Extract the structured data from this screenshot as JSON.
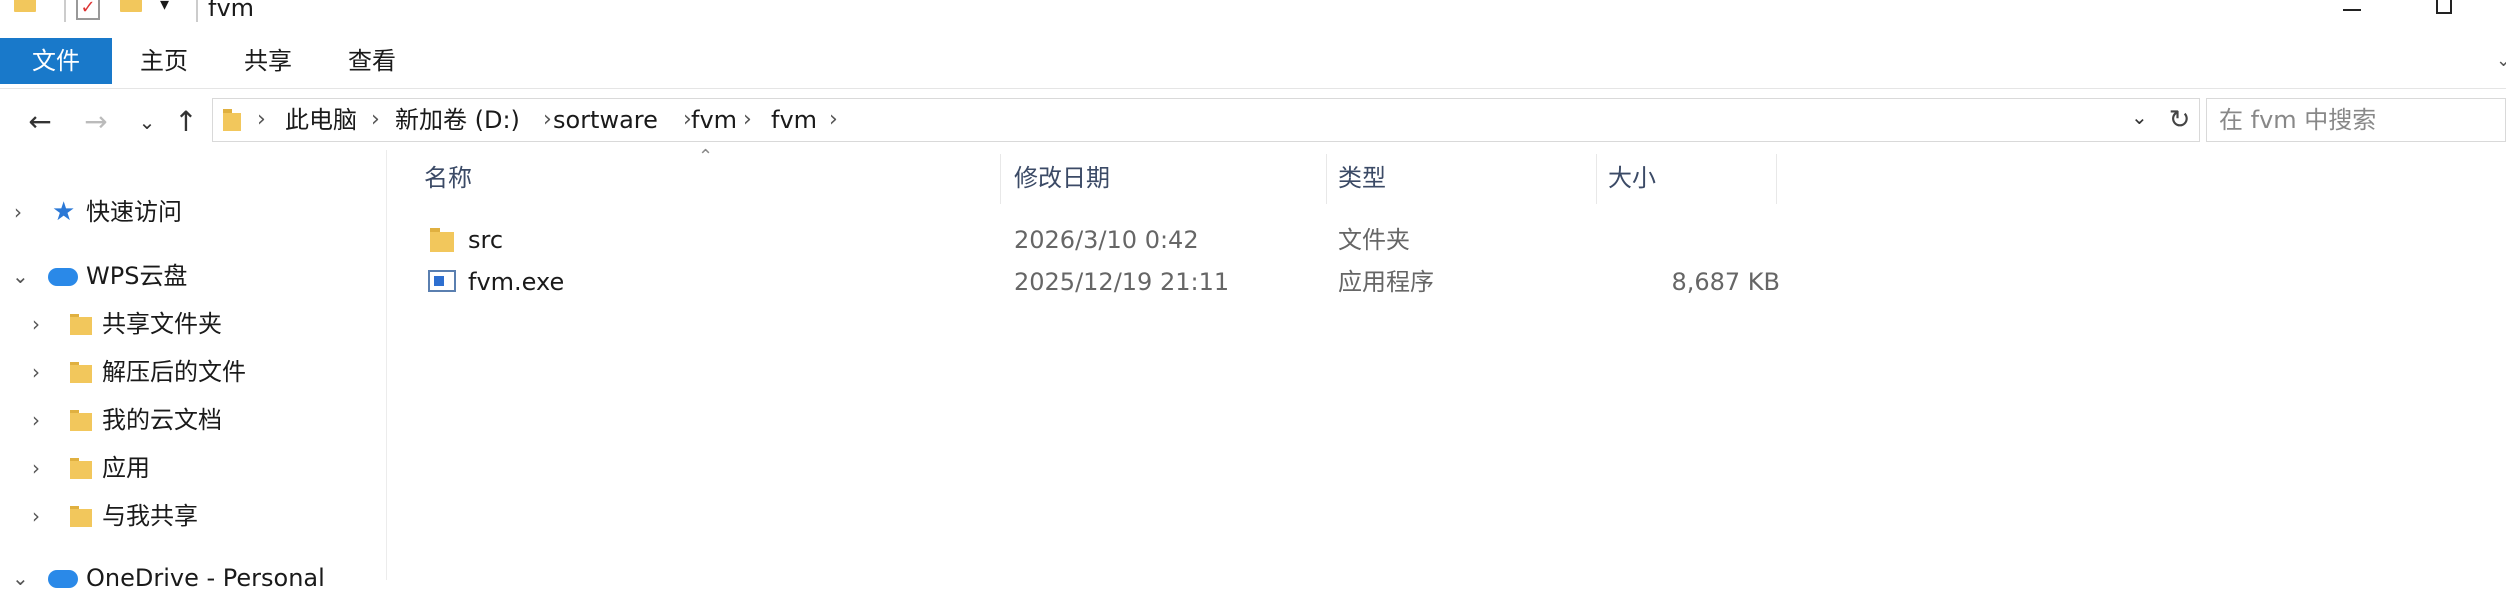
{
  "window": {
    "title": "fvm"
  },
  "ribbon": {
    "tabs": [
      "文件",
      "主页",
      "共享",
      "查看"
    ],
    "active_tab": "文件"
  },
  "address_bar": {
    "breadcrumbs": [
      "此电脑",
      "新加卷 (D:)",
      "sortware",
      "fvm",
      "fvm"
    ]
  },
  "search": {
    "placeholder": "在 fvm 中搜索"
  },
  "nav_pane": {
    "items": [
      {
        "label": "快速访问",
        "icon": "star-icon",
        "expanded": false
      },
      {
        "label": "WPS云盘",
        "icon": "cloud-icon",
        "expanded": true
      },
      {
        "label": "共享文件夹",
        "icon": "shared-folder-icon"
      },
      {
        "label": "解压后的文件",
        "icon": "folder-icon"
      },
      {
        "label": "我的云文档",
        "icon": "folder-icon"
      },
      {
        "label": "应用",
        "icon": "folder-icon"
      },
      {
        "label": "与我共享",
        "icon": "folder-icon"
      },
      {
        "label": "OneDrive - Personal",
        "icon": "onedrive-icon"
      }
    ]
  },
  "file_list": {
    "columns": [
      "名称",
      "修改日期",
      "类型",
      "大小"
    ],
    "rows": [
      {
        "name": "src",
        "modified": "2026/3/10 0:42",
        "type": "文件夹",
        "size": "",
        "icon": "folder-icon"
      },
      {
        "name": "fvm.exe",
        "modified": "2025/12/19 21:11",
        "type": "应用程序",
        "size": "8,687 KB",
        "icon": "exe-icon"
      }
    ]
  },
  "colors": {
    "accent": "#1979ca",
    "folder": "#f2c75c"
  }
}
